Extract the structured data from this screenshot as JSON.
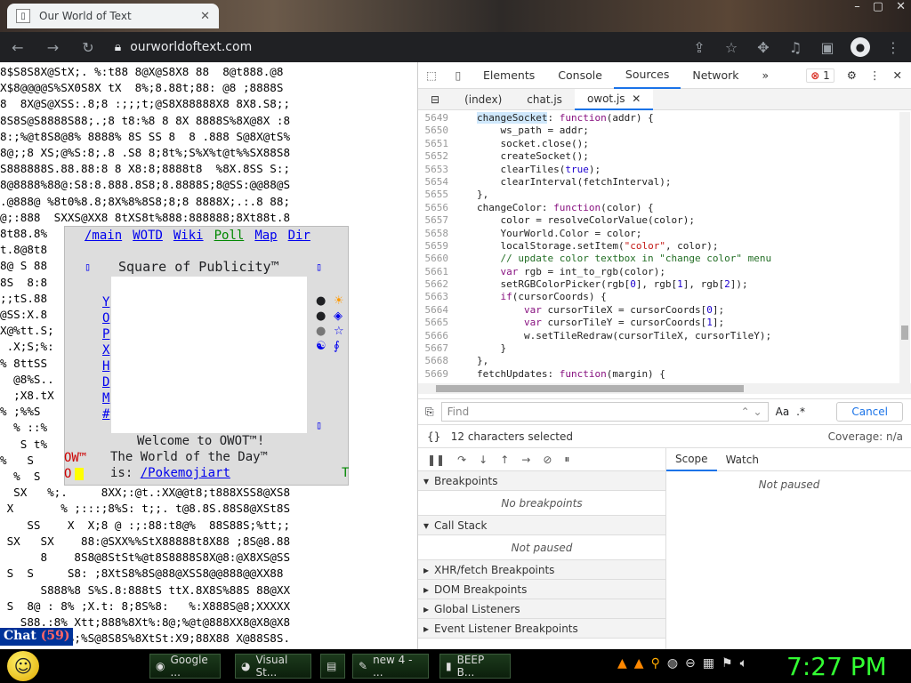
{
  "browser": {
    "tab_title": "Our World of Text",
    "tab_close": "✕",
    "url": "ourworldoftext.com",
    "window_controls": [
      "–",
      "▢",
      "✕"
    ]
  },
  "page": {
    "ascii_lines": [
      "8$S8S8X@StX;. %:t88 8@X@S8X8 88  8@t888.@8",
      "X$8@@@@S%SX0S8X tX  8%;8.88t;88: @8 ;8888S ",
      "8  8X@S@XSS:.8;8 :;;;t;@S8X88888X8 8X8.S8;;",
      "8S8S@S8888S88;.;8 t8:%8 8 8X 8888S%8X@8X :8",
      "8:;%@t8S8@8% 8888% 8S SS 8  8 .888 S@8X@tS%",
      "8@;;8 XS;@%S:8;.8 .S8 8;8t%;S%X%t@t%%SX88S8",
      "S888888S.88.88:8 8 X8:8;8888t8  %8X.8SS S:;",
      "8@8888%88@:S8:8.888.8S8;8.8888S;8@SS:@@88@S",
      ".@888@ %8t0%8.8;8X%8%8S8;8;8 8888X;.:.8 88;",
      "@;:888  SXXS@XX8 8tXS8t%888:888888;8Xt88t.8",
      "8t88.8%",
      "t.8@8t8",
      "8@ S 88",
      "8S  8:8",
      ";;tS.88",
      "@SS:X.8",
      "X@%tt.S;",
      " .X;S;%:",
      "% 8ttSS",
      "  @8%S..",
      "  ;X8.tX",
      "% ;%%S",
      "  % ::%",
      "   S t%",
      "%   S",
      "  %  S",
      "  SX   %;.     8XX;:@t.:XX@@t8;t888XSS8@XS8",
      " X       % ;:::;8%S: t;;. t@8.8S.88S8@XSt8S",
      "    SS    X  X;8 @ :;:88:t8@%  88S88S;%tt;;",
      " SX   SX    88:@SXX%%StX88888t8X88 ;8S@8.88",
      "      8    8S8@8StSt%@t8S8888S8X@8:@X8XS@SS",
      " S  S     S8: ;8XtS8%8S@88@XSS8@@888@@XX88",
      "      S888%8 S%S.8:888tS ttX.8X8S%88S 88@XX",
      " S  8@ : 8% ;X.t: 8;8S%8:   %:X888S@8;XXXXX",
      "   S88.:8% Xtt;888%8Xt%:8@;%@t@888XX8@X8@X8",
      "       S8.S;%S@8S8S%8XtSt:X9;88X88 X@88S8S."
    ],
    "menu": {
      "links": [
        "/main",
        "WOTD",
        "Wiki",
        "Poll",
        "Map",
        "Dir"
      ],
      "title": "Square of Publicity™",
      "side_letters": [
        "Y",
        "O",
        "P",
        "X",
        "H",
        "D",
        "M",
        "#"
      ],
      "glyphs": [
        "●",
        "☀",
        "●",
        "◈",
        "●",
        "☆",
        "☯",
        "∮"
      ],
      "square_glyph": "▯"
    },
    "welcome": "Welcome to OWOT™!",
    "wotd_label": "The World of the Day™",
    "wotd_is": "is:",
    "wotd_link": "/Pokemojiart",
    "wotd_marks": [
      "OW™",
      "O"
    ],
    "green_t": "T",
    "chat_label": "Chat",
    "chat_count": "(59)"
  },
  "devtools": {
    "tabs": [
      "Elements",
      "Console",
      "Sources",
      "Network"
    ],
    "more": "»",
    "error_count": "1",
    "file_tabs": [
      "(index)",
      "chat.js",
      "owot.js"
    ],
    "code_lines": [
      {
        "n": "5649",
        "t": "changeSocket: function(addr) {"
      },
      {
        "n": "5650",
        "t": "    ws_path = addr;"
      },
      {
        "n": "5651",
        "t": "    socket.close();"
      },
      {
        "n": "5652",
        "t": "    createSocket();"
      },
      {
        "n": "5653",
        "t": "    clearTiles(true);"
      },
      {
        "n": "5654",
        "t": "    clearInterval(fetchInterval);"
      },
      {
        "n": "5655",
        "t": "},"
      },
      {
        "n": "5656",
        "t": "changeColor: function(color) {"
      },
      {
        "n": "5657",
        "t": "    color = resolveColorValue(color);"
      },
      {
        "n": "5658",
        "t": "    YourWorld.Color = color;"
      },
      {
        "n": "5659",
        "t": "    localStorage.setItem(\"color\", color);"
      },
      {
        "n": "5660",
        "t": "    // update color textbox in \"change color\" menu"
      },
      {
        "n": "5661",
        "t": "    var rgb = int_to_rgb(color);"
      },
      {
        "n": "5662",
        "t": "    setRGBColorPicker(rgb[0], rgb[1], rgb[2]);"
      },
      {
        "n": "5663",
        "t": "    if(cursorCoords) {"
      },
      {
        "n": "5664",
        "t": "        var cursorTileX = cursorCoords[0];"
      },
      {
        "n": "5665",
        "t": "        var cursorTileY = cursorCoords[1];"
      },
      {
        "n": "5666",
        "t": "        w.setTileRedraw(cursorTileX, cursorTileY);"
      },
      {
        "n": "5667",
        "t": "    }"
      },
      {
        "n": "5668",
        "t": "},"
      },
      {
        "n": "5669",
        "t": "fetchUpdates: function(margin) {"
      }
    ],
    "find_placeholder": "Find",
    "find_case": "Aa",
    "find_regex": ".*",
    "cancel_label": "Cancel",
    "selection_status": "12 characters selected",
    "coverage": "Coverage: n/a",
    "scope_tab": "Scope",
    "watch_tab": "Watch",
    "not_paused_scope": "Not paused",
    "panes": [
      {
        "label": "Breakpoints",
        "body": "No breakpoints",
        "open": true
      },
      {
        "label": "Call Stack",
        "body": "Not paused",
        "open": true
      },
      {
        "label": "XHR/fetch Breakpoints",
        "body": "",
        "open": false
      },
      {
        "label": "DOM Breakpoints",
        "body": "",
        "open": false
      },
      {
        "label": "Global Listeners",
        "body": "",
        "open": false
      },
      {
        "label": "Event Listener Breakpoints",
        "body": "",
        "open": false
      }
    ]
  },
  "taskbar": {
    "items": [
      "Google ...",
      "Visual St...",
      "",
      "new 4 - ...",
      "BEEP B..."
    ],
    "clock": "7:27 PM"
  }
}
